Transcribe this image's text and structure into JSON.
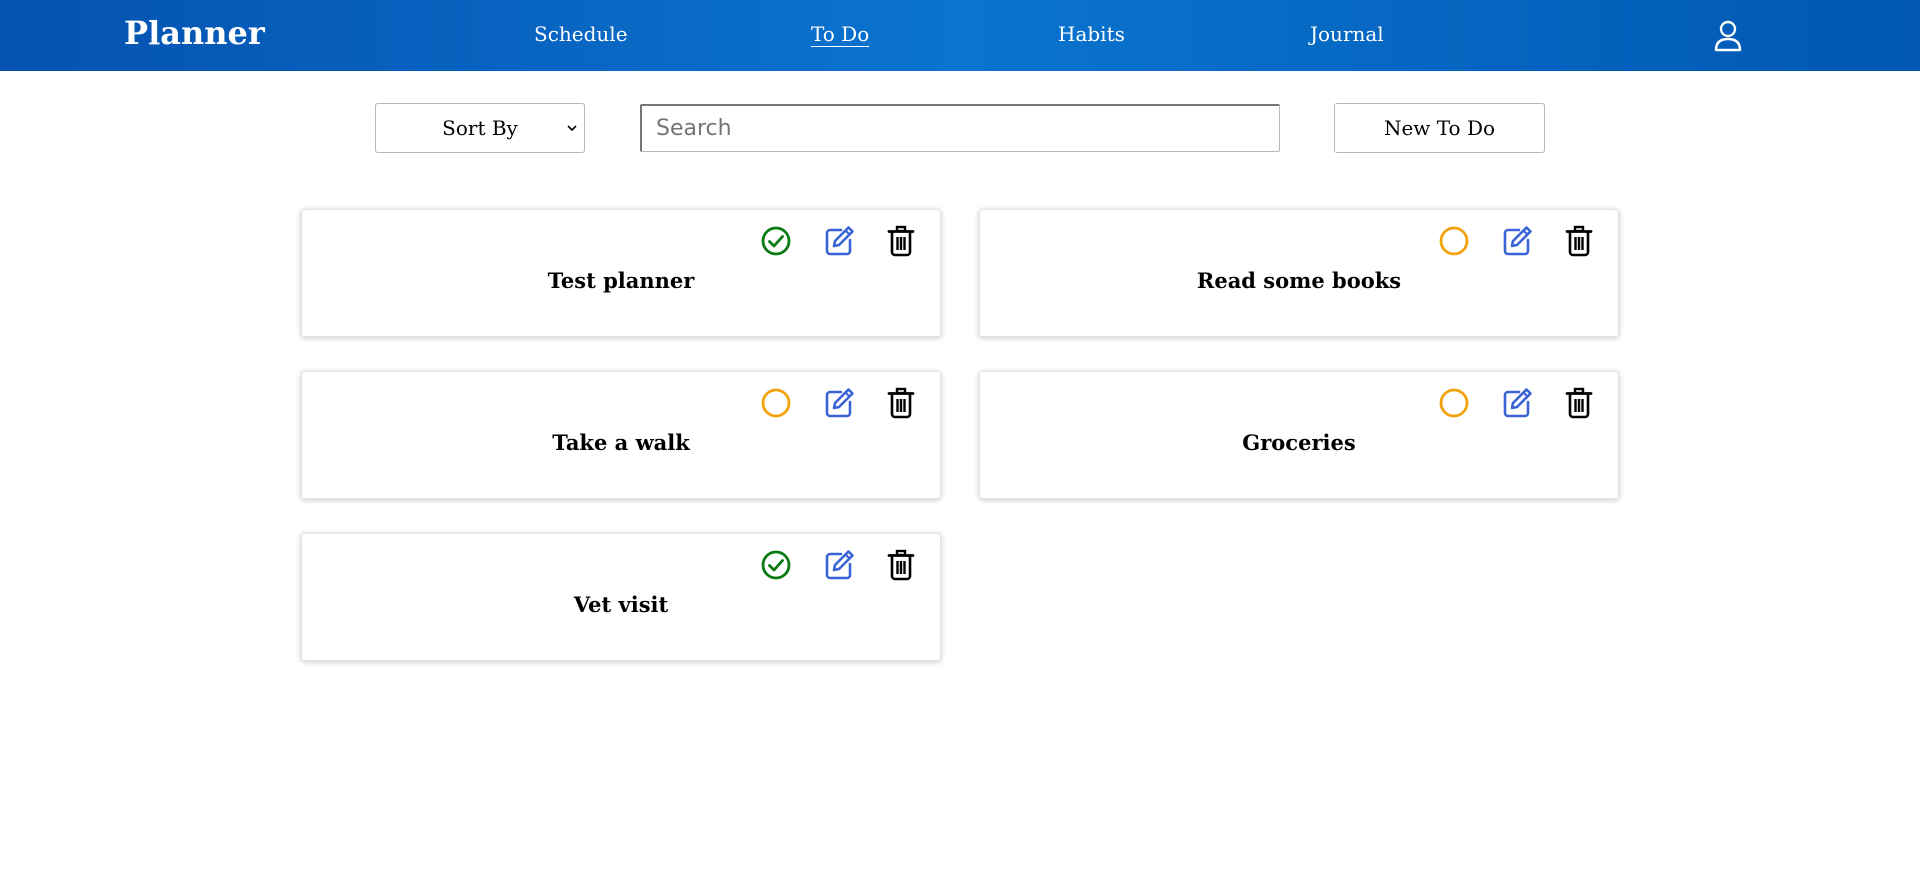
{
  "app": {
    "title": "Planner"
  },
  "nav": {
    "schedule": "Schedule",
    "todo": "To Do",
    "habits": "Habits",
    "journal": "Journal",
    "profile_icon": "user-icon",
    "active": "todo"
  },
  "toolbar": {
    "sort_label": "Sort By",
    "search_placeholder": "Search",
    "search_value": "",
    "new_label": "New To Do"
  },
  "colors": {
    "header_start": "#0552b0",
    "header_mid": "#0a74cf",
    "done": "#0a7a12",
    "pending": "#f2a20c",
    "edit": "#3a63d6",
    "delete": "#000000"
  },
  "todos": [
    {
      "title": "Test planner",
      "status": "done",
      "status_icon": "check-circle-icon"
    },
    {
      "title": "Read some books",
      "status": "pending",
      "status_icon": "circle-icon"
    },
    {
      "title": "Take a walk",
      "status": "pending",
      "status_icon": "circle-icon"
    },
    {
      "title": "Groceries",
      "status": "pending",
      "status_icon": "circle-icon"
    },
    {
      "title": "Vet visit",
      "status": "done",
      "status_icon": "check-circle-icon"
    }
  ]
}
